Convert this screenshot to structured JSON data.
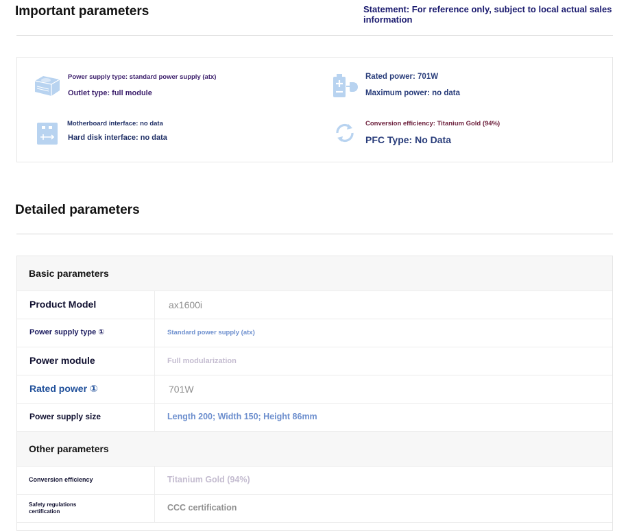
{
  "important": {
    "title": "Important parameters",
    "statement": "Statement: For reference only, subject to local actual sales information",
    "items": [
      {
        "icon": "power-supply-icon",
        "line1": "Power supply type: standard power supply (atx)",
        "line2": "Outlet type: full module"
      },
      {
        "icon": "battery-plug-icon",
        "line1": "Rated power: 701W",
        "line2": "Maximum power: no data"
      },
      {
        "icon": "usb-drive-icon",
        "line1": "Motherboard interface: no data",
        "line2": "Hard disk interface: no data"
      },
      {
        "icon": "refresh-icon",
        "line1": "Conversion efficiency: Titanium Gold (94%)",
        "line2": "PFC Type: No Data"
      }
    ]
  },
  "detailed": {
    "title": "Detailed parameters",
    "groups": [
      {
        "name": "Basic parameters",
        "rows": [
          {
            "key": "Product Model",
            "value": "ax1600i"
          },
          {
            "key": "Power supply type ①",
            "value": "Standard power supply (atx)"
          },
          {
            "key": "Power module",
            "value": "Full modularization"
          },
          {
            "key": "Rated power ①",
            "value": "701W"
          },
          {
            "key": "Power supply size",
            "value": "Length 200; Width 150; Height 86mm"
          }
        ]
      },
      {
        "name": "Other parameters",
        "rows": [
          {
            "key": "Conversion efficiency",
            "value": "Titanium Gold (94%)"
          },
          {
            "key": "Safety regulations certification",
            "value": "CCC certification"
          }
        ]
      }
    ]
  },
  "colors": {
    "icon_blue": "#a9c8ec",
    "text_navy": "#283c7a",
    "text_purple": "#3b1e6b",
    "link_blue": "#1f4f9a",
    "value_blue": "#6d8fce",
    "value_gray": "#8f8f8f",
    "value_light": "#c4bcd0"
  }
}
